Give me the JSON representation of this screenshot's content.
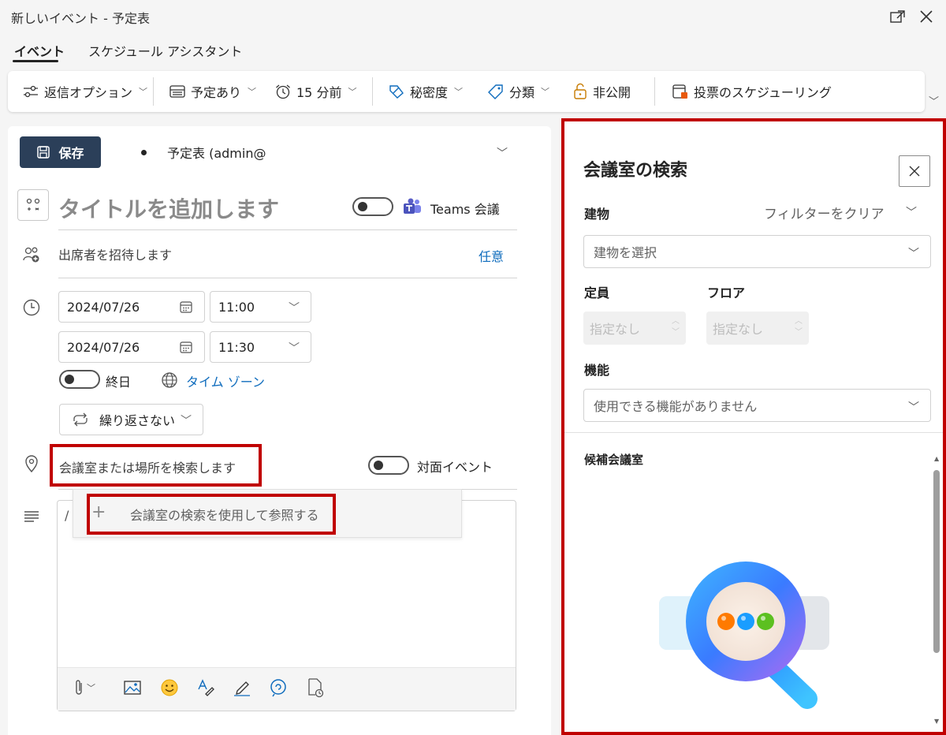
{
  "window": {
    "title": "新しいイベント - 予定表"
  },
  "tabs": [
    {
      "label": "イベント",
      "active": true
    },
    {
      "label": "スケジュール アシスタント",
      "active": false
    }
  ],
  "ribbon": {
    "reply_options": "返信オプション",
    "busy_status": "予定あり",
    "reminder": "15 分前",
    "sensitivity": "秘密度",
    "categorize": "分類",
    "private": "非公開",
    "poll": "投票のスケジューリング"
  },
  "form": {
    "save_label": "保存",
    "calendar": "予定表 (admin@",
    "title_placeholder": "タイトルを追加します",
    "teams_label": "Teams 会議",
    "attendees_placeholder": "出席者を招待します",
    "optional_label": "任意",
    "start_date": "2024/07/26",
    "start_time": "11:00",
    "end_date": "2024/07/26",
    "end_time": "11:30",
    "all_day_label": "終日",
    "timezone_label": "タイム ゾーン",
    "recurrence": "繰り返さない",
    "location_placeholder": "会議室または場所を検索します",
    "in_person_label": "対面イベント",
    "room_finder_option": "会議室の検索を使用して参照する",
    "body_cursor": "/"
  },
  "room_finder": {
    "title": "会議室の検索",
    "building_label": "建物",
    "clear_filter": "フィルターをクリア",
    "building_placeholder": "建物を選択",
    "capacity_label": "定員",
    "floor_label": "フロア",
    "capacity_value": "指定なし",
    "floor_value": "指定なし",
    "features_label": "機能",
    "features_placeholder": "使用できる機能がありません",
    "suggested_label": "候補会議室"
  },
  "colors": {
    "save_button": "#2b3f59",
    "highlight": "#c00000",
    "link": "#0f6cbd",
    "teams": "#5b5fc7"
  }
}
